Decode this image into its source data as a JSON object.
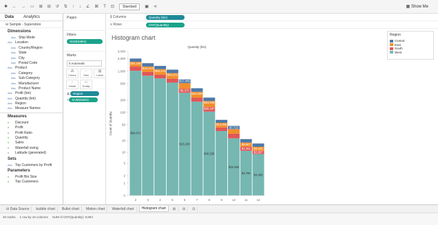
{
  "toolbar": {
    "standard": "Standard",
    "show_me": "Show Me"
  },
  "data_pane": {
    "tabs": [
      "Data",
      "Analytics"
    ],
    "datasource": "Sample - Superstore",
    "dimensions_header": "Dimensions",
    "dimensions": [
      {
        "label": "Ship Mode",
        "indent": 2
      },
      {
        "label": "Location",
        "indent": 1
      },
      {
        "label": "Country/Region",
        "indent": 2
      },
      {
        "label": "State",
        "indent": 2
      },
      {
        "label": "City",
        "indent": 2
      },
      {
        "label": "Postal Code",
        "indent": 2
      },
      {
        "label": "Product",
        "indent": 1
      },
      {
        "label": "Category",
        "indent": 2
      },
      {
        "label": "Sub-Category",
        "indent": 2
      },
      {
        "label": "Manufacturer",
        "indent": 2
      },
      {
        "label": "Product Name",
        "indent": 2
      },
      {
        "label": "Profit (bin)",
        "indent": 1
      },
      {
        "label": "Quantity (bin)",
        "indent": 1
      },
      {
        "label": "Region",
        "indent": 1
      },
      {
        "label": "Measure Names",
        "indent": 1
      }
    ],
    "measures_header": "Measures",
    "measures": [
      "Discount",
      "Profit",
      "Profit Ratio",
      "Quantity",
      "Sales",
      "Waterfall sizing",
      "Latitude (generated)"
    ],
    "sets_header": "Sets",
    "sets": [
      "Top Customers by Profit"
    ],
    "parameters_header": "Parameters",
    "parameters": [
      "Profit Bin Size",
      "Top Customers"
    ]
  },
  "cards": {
    "pages": "Pages",
    "filters": "Filters",
    "filter_pill": "SUM(Sales)",
    "marks": "Marks",
    "marks_type": "Automatic",
    "mark_buttons": [
      "Colour",
      "Size",
      "Label",
      "Detail",
      "Tooltip"
    ],
    "region_pill": "Region",
    "sum_sales_pill": "SUM(Sales)"
  },
  "shelves": {
    "columns_label": "Columns",
    "columns_pill": "Quantity (bin)",
    "rows_label": "Rows",
    "rows_pill": "CNT(Quantity)"
  },
  "view": {
    "title": "Histogram chart"
  },
  "legend": {
    "title": "Region",
    "items": [
      {
        "label": "Central",
        "color": "#4e79a7"
      },
      {
        "label": "East",
        "color": "#f28e2b"
      },
      {
        "label": "South",
        "color": "#e15759"
      },
      {
        "label": "West",
        "color": "#76b7b2"
      }
    ]
  },
  "sheet_tabs": [
    "Data Source",
    "bubble chart",
    "Bullet chart",
    "Motion chart",
    "Waterfall chart",
    "Histogram chart"
  ],
  "active_sheet": "Histogram chart",
  "status": {
    "marks": "40 marks",
    "rows_cols": "1 row by 10 columns",
    "sum": "SUM of CNT(Quantity): 9,994"
  },
  "chart_data": {
    "type": "bar",
    "stacked": true,
    "title": "Histogram chart",
    "xlabel": "Quantity (bin)",
    "ylabel": "Count of Quantity",
    "y_scale": "symlog",
    "ylim": [
      0,
      3000
    ],
    "y_ticks": [
      "0",
      "1",
      "2",
      "5",
      "10",
      "20",
      "50",
      "100",
      "200",
      "500",
      "1,000",
      "2,000",
      "3,000"
    ],
    "categories": [
      "2",
      "3",
      "4",
      "5",
      "6",
      "7",
      "8",
      "9",
      "12",
      "11",
      "14"
    ],
    "series": [
      {
        "name": "West",
        "values": [
          1024,
          780,
          672,
          530,
          300,
          183,
          105,
          35,
          23,
          11,
          9
        ],
        "labels": [
          "$84,672",
          "",
          "",
          "",
          "$16,293",
          "",
          "$40,258",
          "",
          "$15,456",
          "$2,795",
          "$4,490"
        ]
      },
      {
        "name": "South",
        "values": [
          270,
          180,
          150,
          130,
          75,
          45,
          30,
          8,
          7,
          3,
          2
        ],
        "labels": [
          "",
          "",
          "",
          "",
          "$5,375",
          "",
          "$30,187",
          "",
          "",
          "$1,341",
          "$2,907"
        ]
      },
      {
        "name": "East",
        "values": [
          400,
          340,
          300,
          240,
          140,
          90,
          55,
          13,
          9,
          4,
          3
        ],
        "labels": [
          "$82,165",
          "$42,314",
          "$88,223",
          "$86,253",
          "",
          "$34,638",
          "$24,649",
          "$13,085",
          "",
          "$8,807",
          "$3,342"
        ]
      },
      {
        "name": "Central",
        "values": [
          330,
          260,
          220,
          190,
          120,
          70,
          40,
          10,
          8,
          4,
          3
        ],
        "labels": [
          "",
          "",
          "",
          "",
          "$17,466",
          "",
          "",
          "",
          "$7,713",
          "",
          ""
        ]
      }
    ],
    "legend_position": "right",
    "grid": false
  }
}
